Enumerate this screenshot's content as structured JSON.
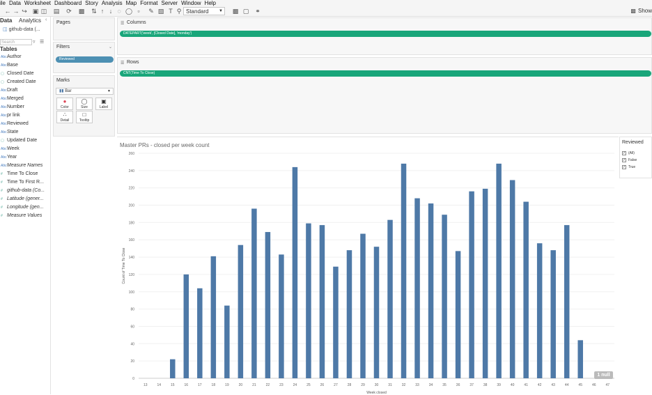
{
  "menu": [
    "ile",
    "Data",
    "Worksheet",
    "Dashboard",
    "Story",
    "Analysis",
    "Map",
    "Format",
    "Server",
    "Window",
    "Help"
  ],
  "toolbar": {
    "mark_type_select": "Standard",
    "show_me": "Show"
  },
  "data_pane": {
    "tab_data": "Data",
    "tab_analytics": "Analytics",
    "datasource": "github-data (...",
    "search_placeholder": "Search",
    "tables_header": "Tables",
    "fields": [
      {
        "label": "Author",
        "type": "dim",
        "italic": false
      },
      {
        "label": "Base",
        "type": "dim",
        "italic": false
      },
      {
        "label": "Closed Date",
        "type": "date",
        "italic": false
      },
      {
        "label": "Created Date",
        "type": "date",
        "italic": false
      },
      {
        "label": "Draft",
        "type": "dim",
        "italic": false
      },
      {
        "label": "Merged",
        "type": "dim",
        "italic": false
      },
      {
        "label": "Number",
        "type": "dim",
        "italic": false
      },
      {
        "label": "pr link",
        "type": "dim",
        "italic": false
      },
      {
        "label": "Reviewed",
        "type": "dim",
        "italic": false
      },
      {
        "label": "State",
        "type": "dim",
        "italic": false
      },
      {
        "label": "Updated Date",
        "type": "date",
        "italic": false
      },
      {
        "label": "Week",
        "type": "dim",
        "italic": false
      },
      {
        "label": "Year",
        "type": "dim",
        "italic": false
      },
      {
        "label": "Measure Names",
        "type": "dim",
        "italic": true
      },
      {
        "label": "Time To Close",
        "type": "measure",
        "italic": false
      },
      {
        "label": "Time To First R...",
        "type": "measure",
        "italic": false
      },
      {
        "label": "github-data (Co...",
        "type": "measure",
        "italic": true
      },
      {
        "label": "Latitude (gener...",
        "type": "measure",
        "italic": true
      },
      {
        "label": "Longitude (gen...",
        "type": "measure",
        "italic": true
      },
      {
        "label": "Measure Values",
        "type": "measure",
        "italic": true
      }
    ]
  },
  "cards": {
    "pages": "Pages",
    "filters": "Filters",
    "filter_pill": "Reviewed",
    "marks": "Marks",
    "mark_type": "Bar",
    "mark_buttons": [
      "Color",
      "Size",
      "Label",
      "Detail",
      "Tooltip"
    ]
  },
  "shelves": {
    "columns_label": "Columns",
    "columns_pill": "DATEPART('week', [Closed Date], 'monday')",
    "rows_label": "Rows",
    "rows_pill": "CNT(Time To Close)"
  },
  "legend": {
    "title": "Reviewed",
    "items": [
      "(All)",
      "False",
      "True"
    ]
  },
  "null_badge": "1 null",
  "bar_color": "#4e79a7",
  "chart_data": {
    "type": "bar",
    "title": "Master PRs - closed per week count",
    "xlabel": "Week closed",
    "ylabel": "Count of Time To Close",
    "ylim": [
      0,
      260
    ],
    "yticks": [
      0,
      20,
      40,
      60,
      80,
      100,
      120,
      140,
      160,
      180,
      200,
      220,
      240,
      260
    ],
    "categories": [
      13,
      14,
      15,
      16,
      17,
      18,
      19,
      20,
      21,
      22,
      23,
      24,
      25,
      26,
      27,
      28,
      29,
      30,
      31,
      32,
      33,
      34,
      35,
      36,
      37,
      38,
      39,
      40,
      41,
      42,
      43,
      44,
      45,
      46,
      47
    ],
    "values": [
      0,
      0,
      22,
      120,
      104,
      141,
      84,
      154,
      196,
      169,
      143,
      244,
      179,
      177,
      129,
      148,
      167,
      152,
      183,
      248,
      208,
      202,
      189,
      147,
      216,
      219,
      248,
      229,
      204,
      156,
      148,
      177,
      44,
      0,
      0
    ]
  }
}
